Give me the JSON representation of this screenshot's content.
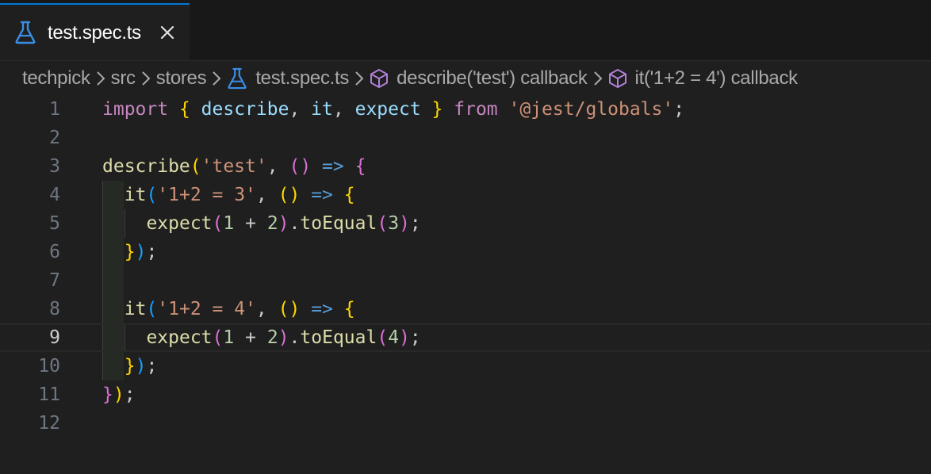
{
  "tab": {
    "label": "test.spec.ts",
    "icon": "flask-icon",
    "close_icon": "close-icon"
  },
  "breadcrumb": [
    {
      "label": "techpick",
      "icon": null
    },
    {
      "label": "src",
      "icon": null
    },
    {
      "label": "stores",
      "icon": null
    },
    {
      "label": "test.spec.ts",
      "icon": "flask-icon"
    },
    {
      "label": "describe('test') callback",
      "icon": "symbol-method-icon"
    },
    {
      "label": "it('1+2 = 4') callback",
      "icon": "symbol-method-icon"
    }
  ],
  "editor": {
    "current_line": 9,
    "lines": [
      {
        "n": "1",
        "text": "import { describe, it, expect } from '@jest/globals';"
      },
      {
        "n": "2",
        "text": ""
      },
      {
        "n": "3",
        "text": "describe('test', () => {"
      },
      {
        "n": "4",
        "text": "  it('1+2 = 3', () => {"
      },
      {
        "n": "5",
        "text": "    expect(1 + 2).toEqual(3);"
      },
      {
        "n": "6",
        "text": "  });"
      },
      {
        "n": "7",
        "text": ""
      },
      {
        "n": "8",
        "text": "  it('1+2 = 4', () => {"
      },
      {
        "n": "9",
        "text": "    expect(1 + 2).toEqual(4);"
      },
      {
        "n": "10",
        "text": "  });"
      },
      {
        "n": "11",
        "text": "});"
      },
      {
        "n": "12",
        "text": ""
      }
    ]
  },
  "colors": {
    "background": "#1f1f1f",
    "tabbar": "#181818",
    "accent": "#0078d4",
    "keyword": "#c586c0",
    "string": "#ce9178",
    "function": "#dcdcaa",
    "variable": "#9cdcfe",
    "number": "#b5cea8"
  }
}
